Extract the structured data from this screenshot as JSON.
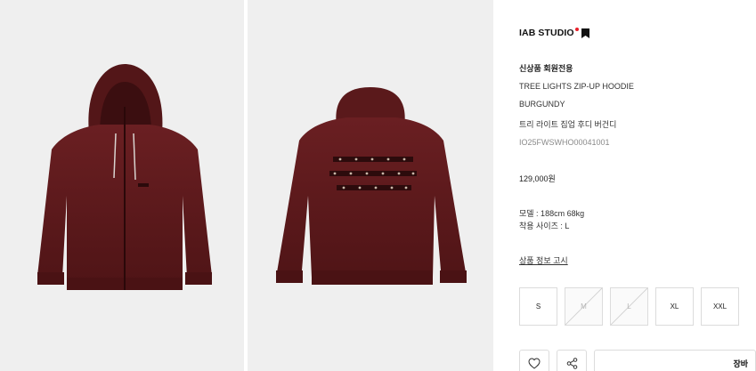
{
  "brand": {
    "name": "IAB STUDIO",
    "icon": "bookmark-icon",
    "dot_color": "#e8202a"
  },
  "product": {
    "tag": "신상품 회원전용",
    "name_en": "TREE LIGHTS ZIP-UP HOODIE",
    "color": "BURGUNDY",
    "name_ko": "트리 라이트 집업 후디 버건디",
    "code": "IO25FWSWHO00041001",
    "price": "129,000원",
    "model_info": "모델 : 188cm 68kg",
    "size_worn": "착용 사이즈 : L",
    "notice_link": "상품 정보 고시",
    "garment_color": "#5e1a1c"
  },
  "sizes": [
    {
      "label": "S",
      "available": true
    },
    {
      "label": "M",
      "available": false
    },
    {
      "label": "L",
      "available": false
    },
    {
      "label": "XL",
      "available": true
    },
    {
      "label": "XXL",
      "available": true
    }
  ],
  "actions": {
    "wishlist_icon": "heart-icon",
    "share_icon": "share-icon",
    "cart_label": "장바"
  }
}
